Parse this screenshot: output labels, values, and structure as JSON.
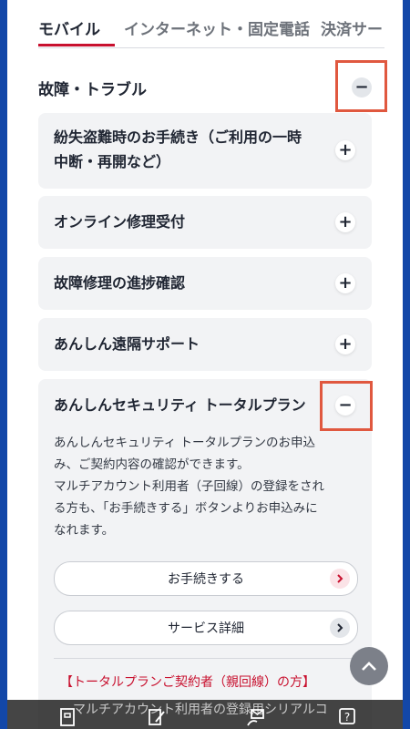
{
  "tabs": [
    {
      "label": "モバイル",
      "active": true
    },
    {
      "label": "インターネット・固定電話",
      "active": false
    },
    {
      "label": "決済サー",
      "active": false
    }
  ],
  "section": {
    "title": "故障・トラブル",
    "toggle": "−"
  },
  "items": [
    {
      "title_line1": "紛失盗難時のお手続き（ご利用の一時",
      "title_line2": "中断・再開など）",
      "toggle": "+"
    },
    {
      "title": "オンライン修理受付",
      "toggle": "+"
    },
    {
      "title": "故障修理の進捗確認",
      "toggle": "+"
    },
    {
      "title": "あんしん遠隔サポート",
      "toggle": "+"
    }
  ],
  "expanded": {
    "title": "あんしんセキュリティ トータルプラン",
    "toggle": "−",
    "body_lines": [
      "あんしんセキュリティ トータルプランのお申込",
      "み、ご契約内容の確認ができます。",
      "マルチアカウント利用者（子回線）の登録をされ",
      "る方も、「お手続きする」ボタンよりお申込みに",
      "なれます。"
    ],
    "primary_button": "お手続きする",
    "secondary_button": "サービス詳細",
    "red_heading": "【トータルプランご契約者（親回線）の方】"
  },
  "bottom": {
    "partial_text": "マルチアカウント利用者の登録用シリアルコ"
  },
  "colors": {
    "accent": "#c8102e",
    "frame": "#1247a8",
    "highlight_box": "#e0583f"
  }
}
